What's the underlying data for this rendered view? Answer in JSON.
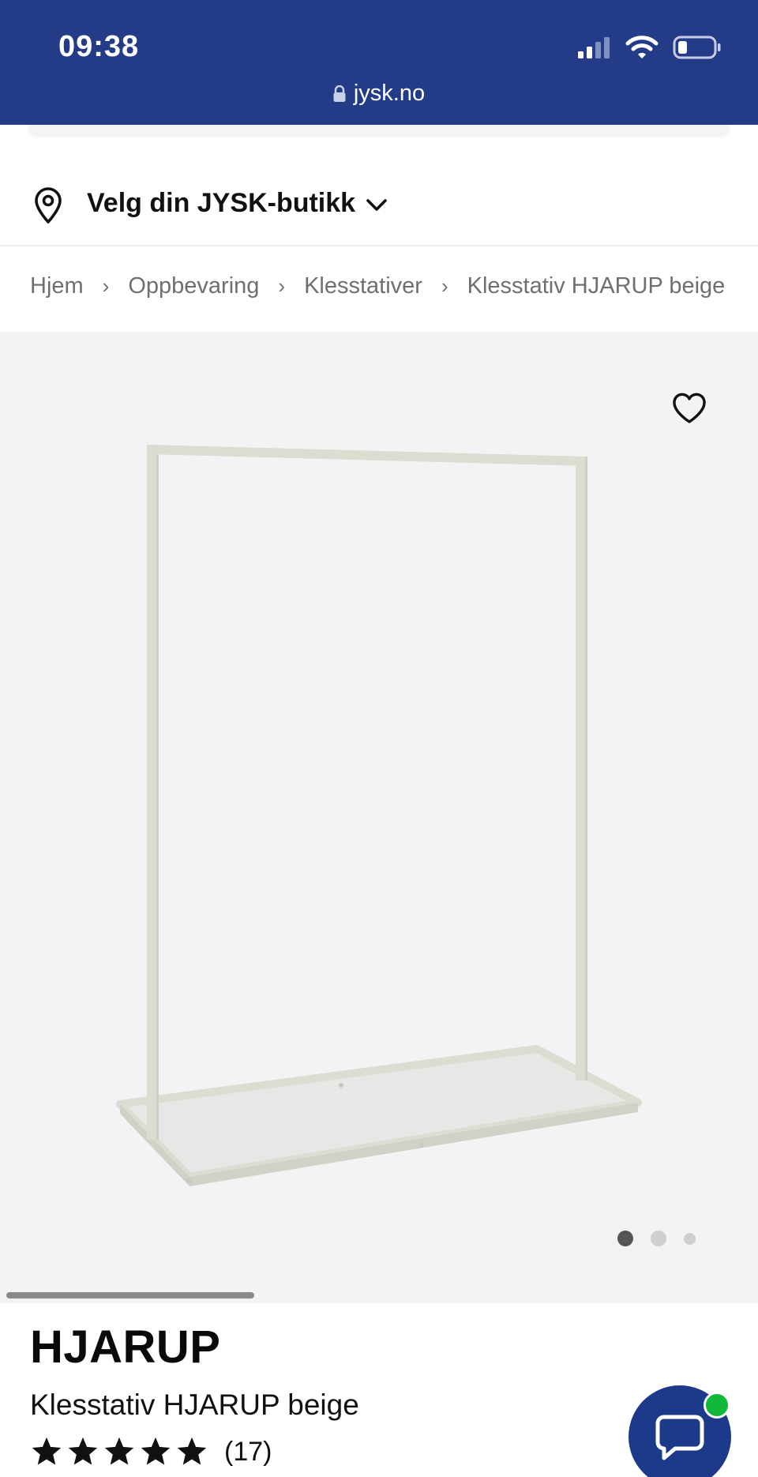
{
  "status_bar": {
    "time": "09:38",
    "url": "jysk.no",
    "background": "#243b87"
  },
  "store_selector": {
    "label": "Velg din JYSK-butikk"
  },
  "breadcrumb": [
    {
      "label": "Hjem"
    },
    {
      "label": "Oppbevaring"
    },
    {
      "label": "Klesstativer"
    },
    {
      "label": "Klesstativ HJARUP beige"
    }
  ],
  "gallery": {
    "image_count": 3,
    "active_index": 0,
    "background": "#f3f3f3"
  },
  "product": {
    "brand": "HJARUP",
    "name": "Klesstativ HJARUP beige",
    "rating_stars": 5,
    "review_count": "(17)"
  },
  "chat": {
    "color": "#1d3a8a",
    "online_color": "#12b83a"
  }
}
